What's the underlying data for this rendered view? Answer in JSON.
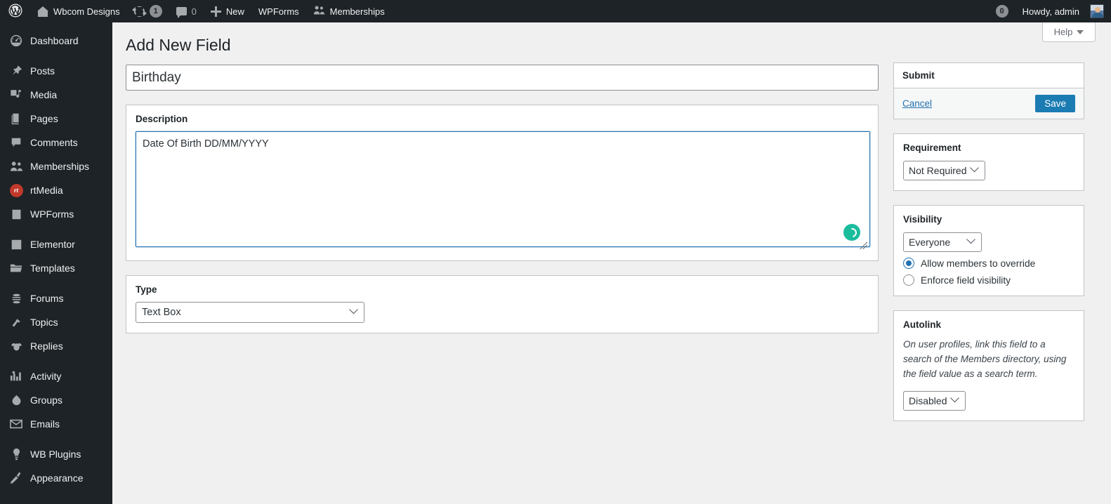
{
  "adminbar": {
    "wp_logo": "wordpress-logo",
    "site_name": "Wbcom Designs",
    "updates_count": "1",
    "comments_count": "0",
    "new_label": "New",
    "wpforms_label": "WPForms",
    "memberships_label": "Memberships",
    "notifications_count": "0",
    "howdy": "Howdy, admin"
  },
  "sidebar": {
    "items": [
      {
        "label": "Dashboard",
        "icon": "dashboard-icon",
        "sep_after": true
      },
      {
        "label": "Posts",
        "icon": "pin-icon",
        "sep_after": false
      },
      {
        "label": "Media",
        "icon": "media-icon",
        "sep_after": false
      },
      {
        "label": "Pages",
        "icon": "pages-icon",
        "sep_after": false
      },
      {
        "label": "Comments",
        "icon": "comments-icon",
        "sep_after": false
      },
      {
        "label": "Memberships",
        "icon": "buddypress-icon",
        "sep_after": false
      },
      {
        "label": "rtMedia",
        "icon": "rtmedia-icon",
        "sep_after": false
      },
      {
        "label": "WPForms",
        "icon": "wpforms-icon",
        "sep_after": true
      },
      {
        "label": "Elementor",
        "icon": "elementor-icon",
        "sep_after": false
      },
      {
        "label": "Templates",
        "icon": "folder-icon",
        "sep_after": true
      },
      {
        "label": "Forums",
        "icon": "forums-icon",
        "sep_after": false
      },
      {
        "label": "Topics",
        "icon": "topics-icon",
        "sep_after": false
      },
      {
        "label": "Replies",
        "icon": "replies-icon",
        "sep_after": true
      },
      {
        "label": "Activity",
        "icon": "activity-icon",
        "sep_after": false
      },
      {
        "label": "Groups",
        "icon": "groups-icon",
        "sep_after": false
      },
      {
        "label": "Emails",
        "icon": "email-icon",
        "sep_after": true
      },
      {
        "label": "WB Plugins",
        "icon": "lightbulb-icon",
        "sep_after": false
      },
      {
        "label": "Appearance",
        "icon": "appearance-icon",
        "sep_after": false
      }
    ]
  },
  "content": {
    "help_label": "Help",
    "page_title": "Add New Field",
    "field_title_value": "Birthday",
    "field_title_placeholder": "Field title",
    "description_label": "Description",
    "description_value": "Date Of Birth DD/MM/YYYY",
    "description_placeholder": "",
    "type_label": "Type",
    "type_value": "Text Box"
  },
  "submit_box": {
    "title": "Submit",
    "cancel_label": "Cancel",
    "save_label": "Save"
  },
  "requirement_box": {
    "title": "Requirement",
    "value": "Not Required"
  },
  "visibility_box": {
    "title": "Visibility",
    "value": "Everyone",
    "radio_override": "Allow members to override",
    "radio_enforce": "Enforce field visibility"
  },
  "autolink_box": {
    "title": "Autolink",
    "description": "On user profiles, link this field to a search of the Members directory, using the field value as a search term.",
    "value": "Disabled"
  },
  "colors": {
    "admin_bar_bg": "#1d2327",
    "sidebar_bg": "#1d2327",
    "content_bg": "#f0f0f1",
    "save_button": "#1b7cb3",
    "link": "#2271b1",
    "focus_border": "#2271b1",
    "spinner": "#1abc9c",
    "rtmedia_badge": "#c0392b"
  }
}
